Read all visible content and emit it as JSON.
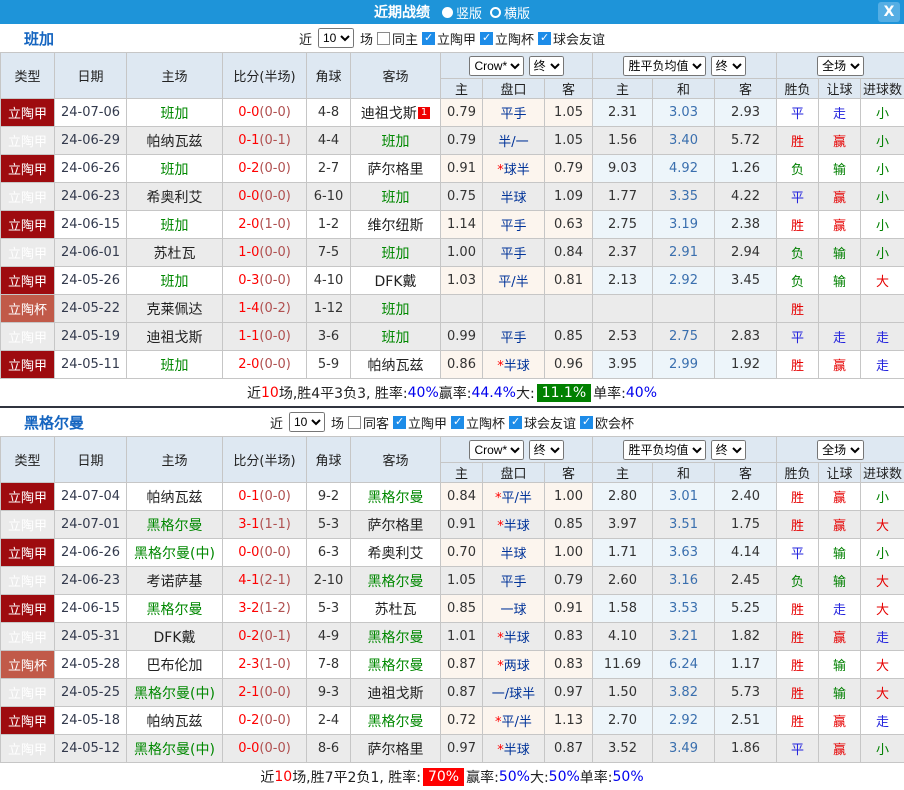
{
  "titlebar": {
    "title": "近期战绩",
    "vertical_label": "竖版",
    "horizontal_label": "横版",
    "selected_layout": "竖版",
    "close_label": "X"
  },
  "colors": {
    "titlebar_blue": "#1e94d9",
    "league_red": "#9e0b0f",
    "cup_red": "#c15a49",
    "win_red": "#e60000",
    "draw_blue": "#2222dd",
    "lose_green": "#008000",
    "team_highlight_green": "#008800",
    "handicap_navy": "#003399",
    "header_bg": "#dee8f2"
  },
  "table_header": {
    "cols": [
      "类型",
      "日期",
      "主场",
      "比分(半场)",
      "角球",
      "客场"
    ],
    "odds_select": "Crow*",
    "odds_final_select": "终",
    "odds_cols": [
      "主",
      "盘口",
      "客"
    ],
    "mean_select": "胜平负均值",
    "mean_final_select": "终",
    "mean_cols": [
      "主",
      "和",
      "客"
    ],
    "scope_select": "全场",
    "result_cols": [
      "胜负",
      "让球",
      "进球数"
    ]
  },
  "sections": [
    {
      "team": "班加",
      "filters": {
        "near_label": "近",
        "games": "10",
        "games_label": "场",
        "same_label": "同主",
        "same_checked": false,
        "leagues": [
          {
            "label": "立陶甲",
            "checked": true
          },
          {
            "label": "立陶杯",
            "checked": true
          },
          {
            "label": "球会友谊",
            "checked": true
          }
        ]
      },
      "rows": [
        {
          "type": "立陶甲",
          "cup": false,
          "date": "24-07-06",
          "home": "班加",
          "home_hl": true,
          "score": "0-0",
          "half": "(0-0)",
          "corner": "4-8",
          "away": "迪祖戈斯",
          "away_hl": false,
          "badge": "1",
          "o1": "0.79",
          "star": false,
          "hcap": "平手",
          "o2": "1.05",
          "m1": "2.31",
          "m2": "3.03",
          "m3": "2.93",
          "res": {
            "t": "平",
            "c": "blue"
          },
          "let": {
            "t": "走",
            "c": "blue"
          },
          "goal": {
            "t": "小",
            "c": "green"
          },
          "shade": false
        },
        {
          "type": "立陶甲",
          "cup": false,
          "date": "24-06-29",
          "home": "帕纳瓦兹",
          "home_hl": false,
          "score": "0-1",
          "half": "(0-1)",
          "corner": "4-4",
          "away": "班加",
          "away_hl": true,
          "o1": "0.79",
          "star": false,
          "hcap": "半/一",
          "o2": "1.05",
          "m1": "1.56",
          "m2": "3.40",
          "m3": "5.72",
          "res": {
            "t": "胜",
            "c": "red"
          },
          "let": {
            "t": "赢",
            "c": "red"
          },
          "goal": {
            "t": "小",
            "c": "green"
          },
          "shade": true
        },
        {
          "type": "立陶甲",
          "cup": false,
          "date": "24-06-26",
          "home": "班加",
          "home_hl": true,
          "score": "0-2",
          "half": "(0-0)",
          "corner": "2-7",
          "away": "萨尔格里",
          "away_hl": false,
          "o1": "0.91",
          "star": true,
          "hcap": "球半",
          "o2": "0.79",
          "m1": "9.03",
          "m2": "4.92",
          "m3": "1.26",
          "res": {
            "t": "负",
            "c": "green"
          },
          "let": {
            "t": "输",
            "c": "green"
          },
          "goal": {
            "t": "小",
            "c": "green"
          },
          "shade": false
        },
        {
          "type": "立陶甲",
          "cup": false,
          "date": "24-06-23",
          "home": "希奥利艾",
          "home_hl": false,
          "score": "0-0",
          "half": "(0-0)",
          "corner": "6-10",
          "away": "班加",
          "away_hl": true,
          "o1": "0.75",
          "star": false,
          "hcap": "半球",
          "o2": "1.09",
          "m1": "1.77",
          "m2": "3.35",
          "m3": "4.22",
          "res": {
            "t": "平",
            "c": "blue"
          },
          "let": {
            "t": "赢",
            "c": "red"
          },
          "goal": {
            "t": "小",
            "c": "green"
          },
          "shade": true
        },
        {
          "type": "立陶甲",
          "cup": false,
          "date": "24-06-15",
          "home": "班加",
          "home_hl": true,
          "score": "2-0",
          "half": "(1-0)",
          "corner": "1-2",
          "away": "维尔纽斯",
          "away_hl": false,
          "o1": "1.14",
          "star": false,
          "hcap": "平手",
          "o2": "0.63",
          "m1": "2.75",
          "m2": "3.19",
          "m3": "2.38",
          "res": {
            "t": "胜",
            "c": "red"
          },
          "let": {
            "t": "赢",
            "c": "red"
          },
          "goal": {
            "t": "小",
            "c": "green"
          },
          "shade": false
        },
        {
          "type": "立陶甲",
          "cup": false,
          "date": "24-06-01",
          "home": "苏杜瓦",
          "home_hl": false,
          "score": "1-0",
          "half": "(0-0)",
          "corner": "7-5",
          "away": "班加",
          "away_hl": true,
          "o1": "1.00",
          "star": false,
          "hcap": "平手",
          "o2": "0.84",
          "m1": "2.37",
          "m2": "2.91",
          "m3": "2.94",
          "res": {
            "t": "负",
            "c": "green"
          },
          "let": {
            "t": "输",
            "c": "green"
          },
          "goal": {
            "t": "小",
            "c": "green"
          },
          "shade": true
        },
        {
          "type": "立陶甲",
          "cup": false,
          "date": "24-05-26",
          "home": "班加",
          "home_hl": true,
          "score": "0-3",
          "half": "(0-0)",
          "corner": "4-10",
          "away": "DFK戴",
          "away_hl": false,
          "o1": "1.03",
          "star": false,
          "hcap": "平/半",
          "o2": "0.81",
          "m1": "2.13",
          "m2": "2.92",
          "m3": "3.45",
          "res": {
            "t": "负",
            "c": "green"
          },
          "let": {
            "t": "输",
            "c": "green"
          },
          "goal": {
            "t": "大",
            "c": "red"
          },
          "shade": false
        },
        {
          "type": "立陶杯",
          "cup": true,
          "date": "24-05-22",
          "home": "克莱佩达",
          "home_hl": false,
          "score": "1-4",
          "half": "(0-2)",
          "corner": "1-12",
          "away": "班加",
          "away_hl": true,
          "o1": "",
          "star": false,
          "hcap": "",
          "o2": "",
          "m1": "",
          "m2": "",
          "m3": "",
          "res": {
            "t": "胜",
            "c": "red"
          },
          "let": {
            "t": "",
            "c": "none"
          },
          "goal": {
            "t": "",
            "c": "none"
          },
          "shade": true
        },
        {
          "type": "立陶甲",
          "cup": false,
          "date": "24-05-19",
          "home": "迪祖戈斯",
          "home_hl": false,
          "score": "1-1",
          "half": "(0-0)",
          "corner": "3-6",
          "away": "班加",
          "away_hl": true,
          "o1": "0.99",
          "star": false,
          "hcap": "平手",
          "o2": "0.85",
          "m1": "2.53",
          "m2": "2.75",
          "m3": "2.83",
          "res": {
            "t": "平",
            "c": "blue"
          },
          "let": {
            "t": "走",
            "c": "blue"
          },
          "goal": {
            "t": "走",
            "c": "blue"
          },
          "shade": true
        },
        {
          "type": "立陶甲",
          "cup": false,
          "date": "24-05-11",
          "home": "班加",
          "home_hl": true,
          "score": "2-0",
          "half": "(0-0)",
          "corner": "5-9",
          "away": "帕纳瓦兹",
          "away_hl": false,
          "o1": "0.86",
          "star": true,
          "hcap": "半球",
          "o2": "0.96",
          "m1": "3.95",
          "m2": "2.99",
          "m3": "1.92",
          "res": {
            "t": "胜",
            "c": "red"
          },
          "let": {
            "t": "赢",
            "c": "red"
          },
          "goal": {
            "t": "走",
            "c": "blue"
          },
          "shade": false
        }
      ],
      "summary": [
        {
          "t": "近"
        },
        {
          "t": "10",
          "cls": "red"
        },
        {
          "t": "场,胜4平3负3, 胜率:"
        },
        {
          "t": "40%",
          "cls": "blue"
        },
        {
          "t": " 赢率:"
        },
        {
          "t": "44.4%",
          "cls": "blue"
        },
        {
          "t": " 大:"
        },
        {
          "t": "11.1%",
          "cls": "hl-green"
        },
        {
          "t": " 单率:"
        },
        {
          "t": "40%",
          "cls": "blue"
        }
      ]
    },
    {
      "team": "黑格尔曼",
      "filters": {
        "near_label": "近",
        "games": "10",
        "games_label": "场",
        "same_label": "同客",
        "same_checked": false,
        "leagues": [
          {
            "label": "立陶甲",
            "checked": true
          },
          {
            "label": "立陶杯",
            "checked": true
          },
          {
            "label": "球会友谊",
            "checked": true
          },
          {
            "label": "欧会杯",
            "checked": true
          }
        ]
      },
      "rows": [
        {
          "type": "立陶甲",
          "cup": false,
          "date": "24-07-04",
          "home": "帕纳瓦兹",
          "home_hl": false,
          "score": "0-1",
          "half": "(0-0)",
          "corner": "9-2",
          "away": "黑格尔曼",
          "away_hl": true,
          "o1": "0.84",
          "star": true,
          "hcap": "平/半",
          "o2": "1.00",
          "m1": "2.80",
          "m2": "3.01",
          "m3": "2.40",
          "res": {
            "t": "胜",
            "c": "red"
          },
          "let": {
            "t": "赢",
            "c": "red"
          },
          "goal": {
            "t": "小",
            "c": "green"
          },
          "shade": false
        },
        {
          "type": "立陶甲",
          "cup": false,
          "date": "24-07-01",
          "home": "黑格尔曼",
          "home_hl": true,
          "score": "3-1",
          "half": "(1-1)",
          "corner": "5-3",
          "away": "萨尔格里",
          "away_hl": false,
          "o1": "0.91",
          "star": true,
          "hcap": "半球",
          "o2": "0.85",
          "m1": "3.97",
          "m2": "3.51",
          "m3": "1.75",
          "res": {
            "t": "胜",
            "c": "red"
          },
          "let": {
            "t": "赢",
            "c": "red"
          },
          "goal": {
            "t": "大",
            "c": "red"
          },
          "shade": true
        },
        {
          "type": "立陶甲",
          "cup": false,
          "date": "24-06-26",
          "home": "黑格尔曼(中)",
          "home_hl": true,
          "score": "0-0",
          "half": "(0-0)",
          "corner": "6-3",
          "away": "希奥利艾",
          "away_hl": false,
          "o1": "0.70",
          "star": false,
          "hcap": "半球",
          "o2": "1.00",
          "m1": "1.71",
          "m2": "3.63",
          "m3": "4.14",
          "res": {
            "t": "平",
            "c": "blue"
          },
          "let": {
            "t": "输",
            "c": "green"
          },
          "goal": {
            "t": "小",
            "c": "green"
          },
          "shade": false
        },
        {
          "type": "立陶甲",
          "cup": false,
          "date": "24-06-23",
          "home": "考诺萨基",
          "home_hl": false,
          "score": "4-1",
          "half": "(2-1)",
          "corner": "2-10",
          "away": "黑格尔曼",
          "away_hl": true,
          "o1": "1.05",
          "star": false,
          "hcap": "平手",
          "o2": "0.79",
          "m1": "2.60",
          "m2": "3.16",
          "m3": "2.45",
          "res": {
            "t": "负",
            "c": "green"
          },
          "let": {
            "t": "输",
            "c": "green"
          },
          "goal": {
            "t": "大",
            "c": "red"
          },
          "shade": true
        },
        {
          "type": "立陶甲",
          "cup": false,
          "date": "24-06-15",
          "home": "黑格尔曼",
          "home_hl": true,
          "score": "3-2",
          "half": "(1-2)",
          "corner": "5-3",
          "away": "苏杜瓦",
          "away_hl": false,
          "o1": "0.85",
          "star": false,
          "hcap": "一球",
          "o2": "0.91",
          "m1": "1.58",
          "m2": "3.53",
          "m3": "5.25",
          "res": {
            "t": "胜",
            "c": "red"
          },
          "let": {
            "t": "走",
            "c": "blue"
          },
          "goal": {
            "t": "大",
            "c": "red"
          },
          "shade": false
        },
        {
          "type": "立陶甲",
          "cup": false,
          "date": "24-05-31",
          "home": "DFK戴",
          "home_hl": false,
          "score": "0-2",
          "half": "(0-1)",
          "corner": "4-9",
          "away": "黑格尔曼",
          "away_hl": true,
          "o1": "1.01",
          "star": true,
          "hcap": "半球",
          "o2": "0.83",
          "m1": "4.10",
          "m2": "3.21",
          "m3": "1.82",
          "res": {
            "t": "胜",
            "c": "red"
          },
          "let": {
            "t": "赢",
            "c": "red"
          },
          "goal": {
            "t": "走",
            "c": "blue"
          },
          "shade": true
        },
        {
          "type": "立陶杯",
          "cup": true,
          "date": "24-05-28",
          "home": "巴布伦加",
          "home_hl": false,
          "score": "2-3",
          "half": "(1-0)",
          "corner": "7-8",
          "away": "黑格尔曼",
          "away_hl": true,
          "o1": "0.87",
          "star": true,
          "hcap": "两球",
          "o2": "0.83",
          "m1": "11.69",
          "m2": "6.24",
          "m3": "1.17",
          "res": {
            "t": "胜",
            "c": "red"
          },
          "let": {
            "t": "输",
            "c": "green"
          },
          "goal": {
            "t": "大",
            "c": "red"
          },
          "shade": false
        },
        {
          "type": "立陶甲",
          "cup": false,
          "date": "24-05-25",
          "home": "黑格尔曼(中)",
          "home_hl": true,
          "score": "2-1",
          "half": "(0-0)",
          "corner": "9-3",
          "away": "迪祖戈斯",
          "away_hl": false,
          "o1": "0.87",
          "star": false,
          "hcap": "一/球半",
          "o2": "0.97",
          "m1": "1.50",
          "m2": "3.82",
          "m3": "5.73",
          "res": {
            "t": "胜",
            "c": "red"
          },
          "let": {
            "t": "输",
            "c": "green"
          },
          "goal": {
            "t": "大",
            "c": "red"
          },
          "shade": true
        },
        {
          "type": "立陶甲",
          "cup": false,
          "date": "24-05-18",
          "home": "帕纳瓦兹",
          "home_hl": false,
          "score": "0-2",
          "half": "(0-0)",
          "corner": "2-4",
          "away": "黑格尔曼",
          "away_hl": true,
          "o1": "0.72",
          "star": true,
          "hcap": "平/半",
          "o2": "1.13",
          "m1": "2.70",
          "m2": "2.92",
          "m3": "2.51",
          "res": {
            "t": "胜",
            "c": "red"
          },
          "let": {
            "t": "赢",
            "c": "red"
          },
          "goal": {
            "t": "走",
            "c": "blue"
          },
          "shade": false
        },
        {
          "type": "立陶甲",
          "cup": false,
          "date": "24-05-12",
          "home": "黑格尔曼(中)",
          "home_hl": true,
          "score": "0-0",
          "half": "(0-0)",
          "corner": "8-6",
          "away": "萨尔格里",
          "away_hl": false,
          "o1": "0.97",
          "star": true,
          "hcap": "半球",
          "o2": "0.87",
          "m1": "3.52",
          "m2": "3.49",
          "m3": "1.86",
          "res": {
            "t": "平",
            "c": "blue"
          },
          "let": {
            "t": "赢",
            "c": "red"
          },
          "goal": {
            "t": "小",
            "c": "green"
          },
          "shade": true
        }
      ],
      "summary": [
        {
          "t": "近"
        },
        {
          "t": "10",
          "cls": "red"
        },
        {
          "t": "场,胜7平2负1, 胜率:"
        },
        {
          "t": "70%",
          "cls": "hl-red"
        },
        {
          "t": " 赢率:"
        },
        {
          "t": "50%",
          "cls": "blue"
        },
        {
          "t": " 大:"
        },
        {
          "t": "50%",
          "cls": "blue"
        },
        {
          "t": " 单率:"
        },
        {
          "t": "50%",
          "cls": "blue"
        }
      ]
    }
  ]
}
